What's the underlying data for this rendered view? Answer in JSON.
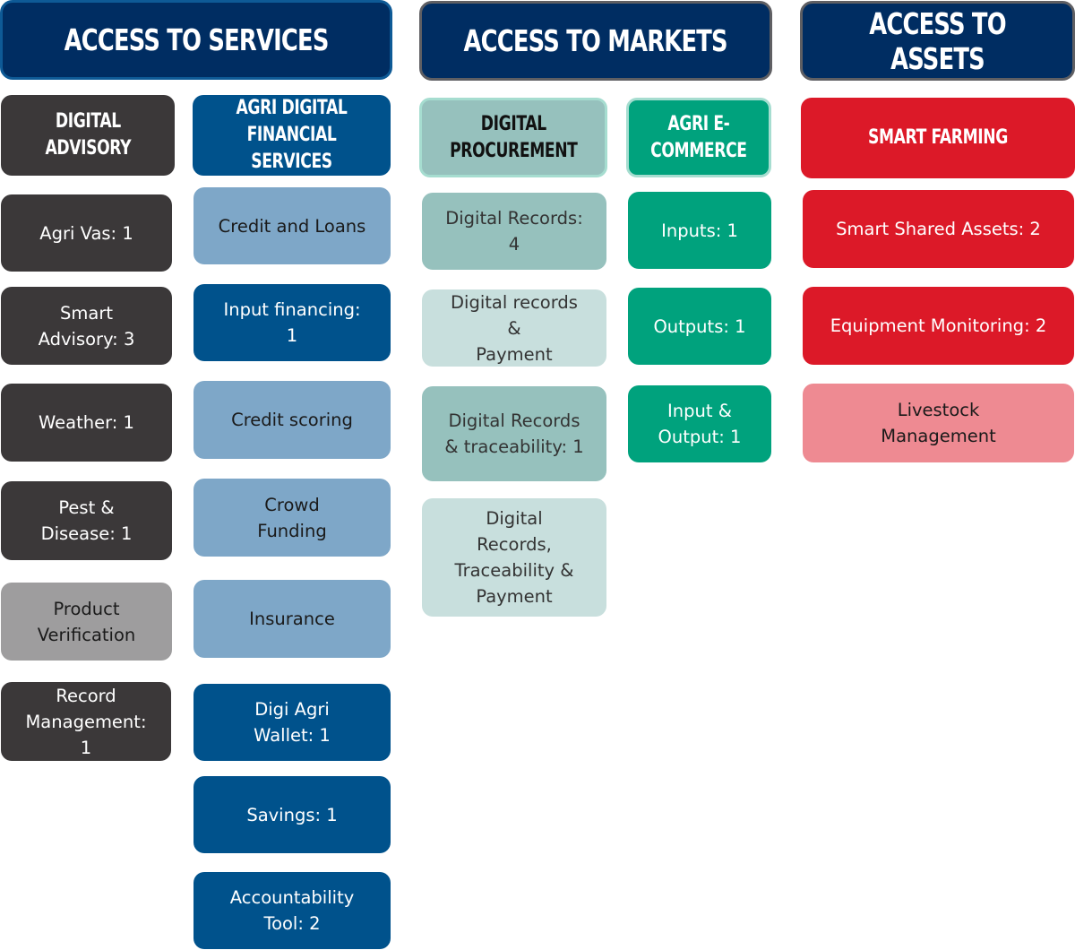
{
  "columns": {
    "services": {
      "header": "ACCESS TO SERVICES",
      "groups": {
        "digital_advisory": {
          "title": "DIGITAL\nADVISORY",
          "items": [
            "Agri Vas: 1",
            "Smart\nAdvisory: 3",
            "Weather: 1",
            "Pest &\nDisease: 1",
            "Product\nVerification",
            "Record\nManagement:\n1"
          ]
        },
        "financial_services": {
          "title": "AGRI DIGITAL\nFINANCIAL SERVICES",
          "items": [
            "Credit and Loans",
            "Input financing:\n1",
            "Credit scoring",
            "Crowd\nFunding",
            "Insurance",
            "Digi Agri\nWallet: 1",
            "Savings: 1",
            "Accountability\nTool: 2"
          ]
        }
      }
    },
    "markets": {
      "header": "ACCESS TO MARKETS",
      "groups": {
        "digital_procurement": {
          "title": "DIGITAL\nPROCUREMENT",
          "items": [
            "Digital Records:\n4",
            "Digital records\n&\nPayment",
            "Digital Records\n& traceability: 1",
            "Digital\nRecords,\nTraceability &\nPayment"
          ]
        },
        "ecommerce": {
          "title": "AGRI E-\nCOMMERCE",
          "items": [
            "Inputs: 1",
            "Outputs: 1",
            "Input &\nOutput: 1"
          ]
        }
      }
    },
    "assets": {
      "header": "ACCESS TO ASSETS",
      "groups": {
        "smart_farming": {
          "title": "SMART FARMING",
          "items": [
            "Smart Shared Assets: 2",
            "Equipment Monitoring: 2",
            "Livestock\nManagement"
          ]
        }
      }
    }
  },
  "colors": {
    "header_navy": "#002d62",
    "advisory_dark": "#3b3839",
    "advisory_inactive_grey": "#9e9d9e",
    "finance_navy": "#00528c",
    "finance_light_blue": "#7ea7c8",
    "procurement_sage": "#96c1bd",
    "procurement_light_sage": "#c8dfdd",
    "ecommerce_teal": "#00a27d",
    "farming_red": "#dc1928",
    "farming_pink": "#ee8a92"
  }
}
